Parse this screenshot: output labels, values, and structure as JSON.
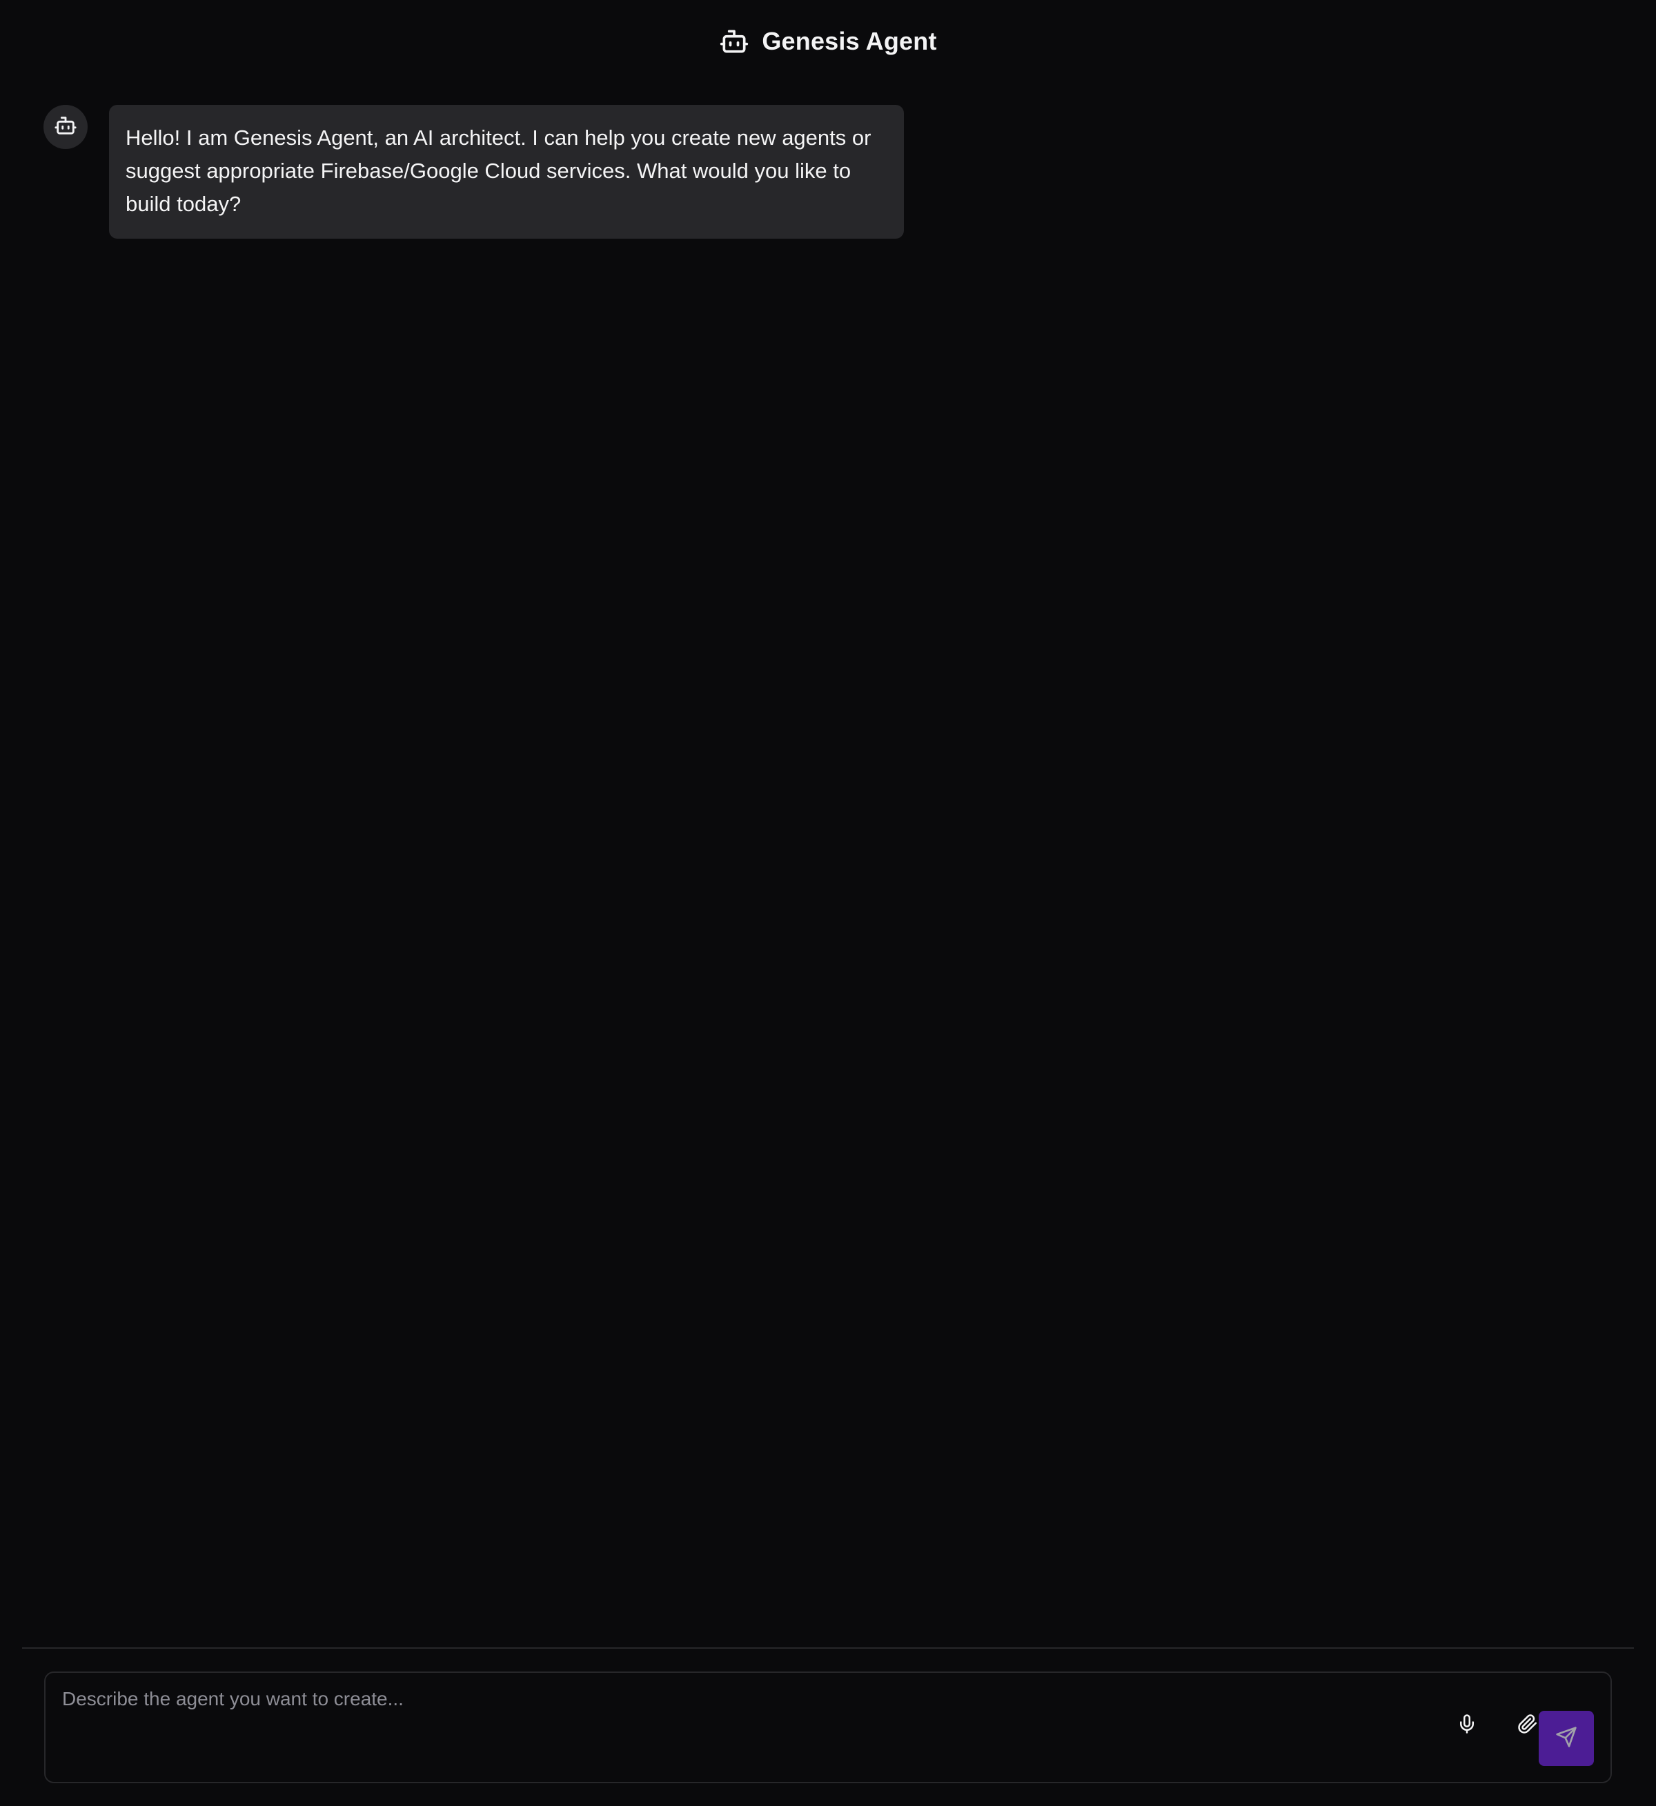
{
  "header": {
    "title": "Genesis Agent",
    "icon": "bot-icon"
  },
  "chat": {
    "messages": [
      {
        "role": "assistant",
        "avatar_icon": "bot-icon",
        "text": "Hello! I am Genesis Agent, an AI architect. I can help you create new agents or suggest appropriate Firebase/Google Cloud services. What would you like to build today?"
      }
    ]
  },
  "composer": {
    "placeholder": "Describe the agent you want to create...",
    "value": "",
    "mic_icon": "mic-icon",
    "attach_icon": "paperclip-icon",
    "send_icon": "send-icon"
  },
  "colors": {
    "background": "#0a0a0c",
    "bubble": "#27272a",
    "accent": "#4c1d95",
    "text": "#f4f4f5",
    "placeholder": "#8e8e96"
  }
}
